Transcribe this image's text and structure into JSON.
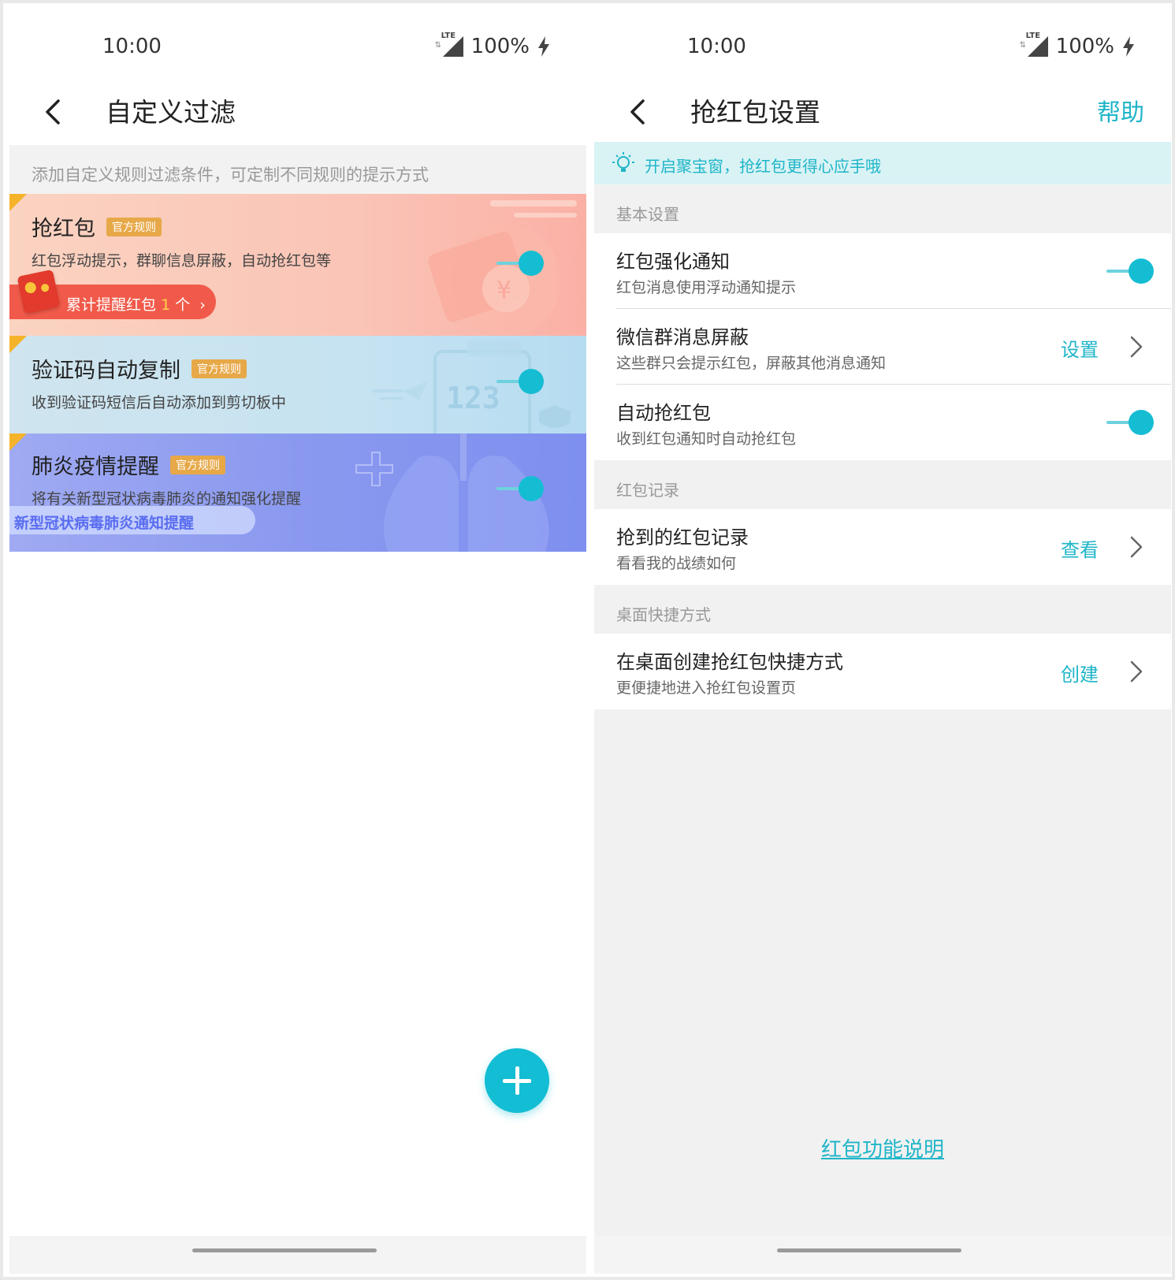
{
  "left": {
    "status": {
      "time": "10:00",
      "network": "LTE",
      "battery": "100%"
    },
    "title": "自定义过滤",
    "description": "添加自定义规则过滤条件，可定制不同规则的提示方式",
    "rules": [
      {
        "title": "抢红包",
        "badge": "官方规则",
        "subtitle": "红包浮动提示，群聊信息屏蔽，自动抢红包等",
        "enabled": true,
        "counter": {
          "prefix": "累计提醒红包",
          "count": "1",
          "suffix": "个"
        }
      },
      {
        "title": "验证码自动复制",
        "badge": "官方规则",
        "subtitle": "收到验证码短信后自动添加到剪切板中",
        "enabled": true
      },
      {
        "title": "肺炎疫情提醒",
        "badge": "官方规则",
        "subtitle": "将有关新型冠状病毒肺炎的通知强化提醒",
        "enabled": true,
        "banner": "新型冠状病毒肺炎通知提醒"
      }
    ],
    "fab_icon": "plus-icon"
  },
  "right": {
    "status": {
      "time": "10:00",
      "network": "LTE",
      "battery": "100%"
    },
    "title": "抢红包设置",
    "help": "帮助",
    "tip": "开启聚宝窗，抢红包更得心应手哦",
    "sections": [
      {
        "header": "基本设置",
        "rows": [
          {
            "name": "红包强化通知",
            "sub": "红包消息使用浮动通知提示",
            "toggle": true
          },
          {
            "name": "微信群消息屏蔽",
            "sub": "这些群只会提示红包，屏蔽其他消息通知",
            "action": "设置"
          },
          {
            "name": "自动抢红包",
            "sub": "收到红包通知时自动抢红包",
            "toggle": true
          }
        ]
      },
      {
        "header": "红包记录",
        "rows": [
          {
            "name": "抢到的红包记录",
            "sub": "看看我的战绩如何",
            "action": "查看"
          }
        ]
      },
      {
        "header": "桌面快捷方式",
        "rows": [
          {
            "name": "在桌面创建抢红包快捷方式",
            "sub": "更便捷地进入抢红包设置页",
            "action": "创建"
          }
        ]
      }
    ],
    "footer_link": "红包功能说明"
  },
  "colors": {
    "accent": "#13bdd3",
    "badge": "#e7a848",
    "red_pill": "#f15a4a",
    "banner_text": "#5a6df0"
  }
}
